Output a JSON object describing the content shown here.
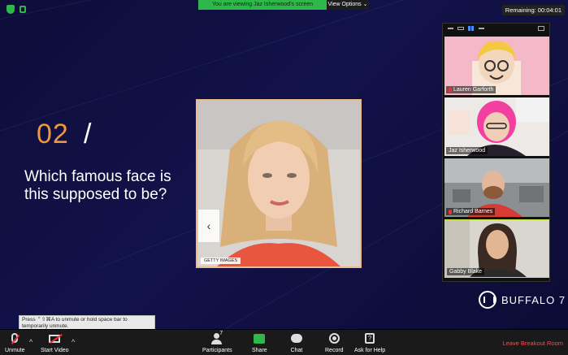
{
  "banner": {
    "viewing_text": "You are viewing Jaz Isherwood's screen",
    "view_options_label": "View Options ⌄"
  },
  "remaining": "Remaining: 00:04:01",
  "slide": {
    "number": "02",
    "slash": "/",
    "question": "Which famous face is this supposed to be?",
    "photo_caption": "GETTY IMAGES",
    "prev_arrow": "‹"
  },
  "participants": [
    {
      "name": "Lauren Garforth",
      "muted": true
    },
    {
      "name": "Jaz Isherwood",
      "muted": false
    },
    {
      "name": "Richard Barnes",
      "muted": true
    },
    {
      "name": "Gabby Blake",
      "muted": false
    }
  ],
  "brand": {
    "name": "BUFFALO 7"
  },
  "tooltip": "Press ⌃⇧⌘A to unmute or hold space bar to temporarily unmute.",
  "toolbar": {
    "unmute": "Unmute",
    "start_video": "Start Video",
    "participants": "Participants",
    "participants_count": "7",
    "share": "Share",
    "chat": "Chat",
    "record": "Record",
    "ask_help": "Ask for Help",
    "help_glyph": "?",
    "leave": "Leave Breakout Room",
    "caret": "^"
  },
  "colors": {
    "accent_orange": "#f0963b",
    "zoom_green": "#2fb84a",
    "leave_red": "#ff4a4a",
    "background": "#12124a"
  }
}
